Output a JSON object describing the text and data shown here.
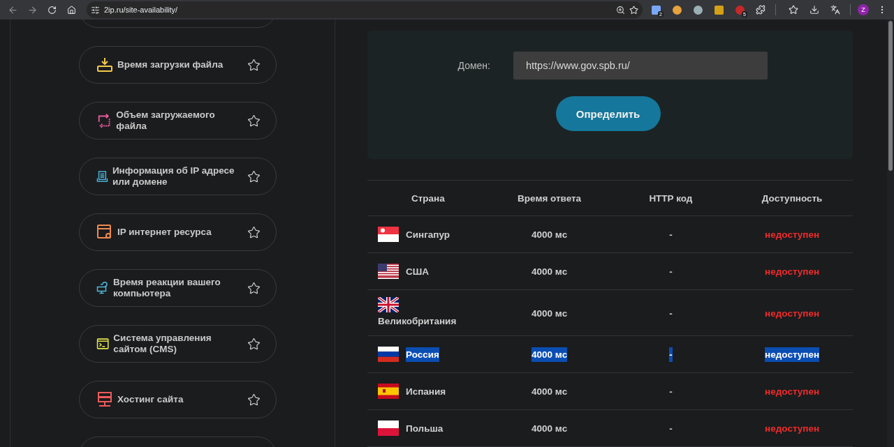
{
  "browser": {
    "url": "2ip.ru/site-availability/",
    "extensions": [
      {
        "kind": "doc",
        "badge": "2"
      },
      {
        "kind": "bear"
      },
      {
        "kind": "glasses"
      },
      {
        "kind": "chest"
      },
      {
        "kind": "red",
        "badge": "5"
      }
    ],
    "avatar": "Z"
  },
  "sidebar": {
    "items": [
      {
        "kind": "download",
        "label": "Время загрузки файла",
        "starred": false
      },
      {
        "kind": "resize",
        "label": "Объем загружаемого файла",
        "starred": false
      },
      {
        "kind": "doc",
        "label": "Информация об IP адресе или домене",
        "starred": false
      },
      {
        "kind": "window",
        "label": "IP интернет ресурса",
        "starred": false
      },
      {
        "kind": "monitor",
        "label": "Время реакции вашего компьютера",
        "starred": false
      },
      {
        "kind": "terminal",
        "label": "Система управления сайтом (CMS)",
        "starred": false
      },
      {
        "kind": "server",
        "label": "Хостинг сайта",
        "starred": false
      }
    ]
  },
  "form": {
    "label": "Домен:",
    "value": "https://www.gov.spb.ru/",
    "button": "Определить"
  },
  "table": {
    "columns": [
      "Страна",
      "Время ответа",
      "HTTP код",
      "Доступность"
    ],
    "rows": [
      {
        "kind": "sg",
        "country": "Сингапур",
        "time": "4000 мс",
        "code": "-",
        "status": "недоступен",
        "available": false,
        "selected": false
      },
      {
        "kind": "us",
        "country": "США",
        "time": "4000 мс",
        "code": "-",
        "status": "недоступен",
        "available": false,
        "selected": false
      },
      {
        "kind": "gb",
        "country": "Великобритания",
        "time": "4000 мс",
        "code": "-",
        "status": "недоступен",
        "available": false,
        "selected": false
      },
      {
        "kind": "ru",
        "country": "Россия",
        "time": "4000 мс",
        "code": "-",
        "status": "недоступен",
        "available": false,
        "selected": true
      },
      {
        "kind": "es",
        "country": "Испания",
        "time": "4000 мс",
        "code": "-",
        "status": "недоступен",
        "available": false,
        "selected": false
      },
      {
        "kind": "pl",
        "country": "Польша",
        "time": "4000 мс",
        "code": "-",
        "status": "недоступен",
        "available": false,
        "selected": false
      }
    ]
  }
}
